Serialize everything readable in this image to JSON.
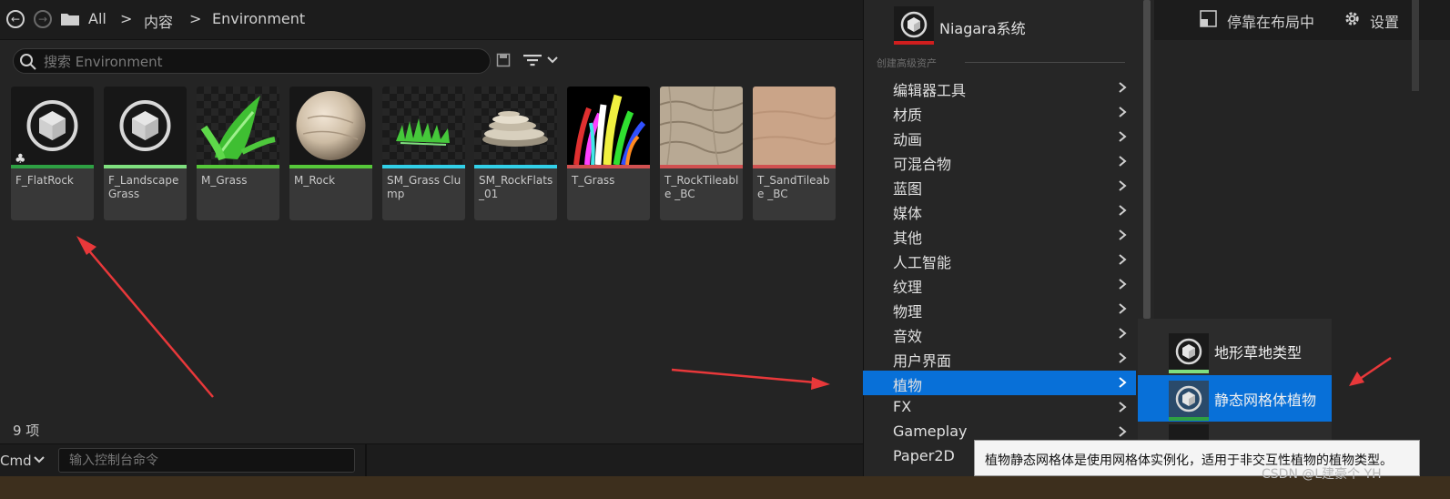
{
  "breadcrumb": {
    "items": [
      "All",
      "内容",
      "Environment"
    ],
    "separator": ">"
  },
  "search": {
    "placeholder": "搜索 Environment",
    "value": ""
  },
  "assets": [
    {
      "name": "F_FlatRock",
      "bar_color": "#2ea043",
      "thumb": "cube-icon"
    },
    {
      "name": "F_Landscape Grass",
      "bar_color": "#7fe07f",
      "thumb": "cube-icon"
    },
    {
      "name": "M_Grass",
      "bar_color": "#56c83a",
      "thumb": "grass-leaf"
    },
    {
      "name": "M_Rock",
      "bar_color": "#56c83a",
      "thumb": "rock-sphere"
    },
    {
      "name": "SM_Grass Clump",
      "bar_color": "#32d0e8",
      "thumb": "grass-clump"
    },
    {
      "name": "SM_RockFlats _01",
      "bar_color": "#32d0e8",
      "thumb": "rock-flats"
    },
    {
      "name": "T_Grass",
      "bar_color": "#d05050",
      "thumb": "grass-texture"
    },
    {
      "name": "T_RockTileable _BC",
      "bar_color": "#d05050",
      "thumb": "rock-texture"
    },
    {
      "name": "T_SandTileabe _BC",
      "bar_color": "#d05050",
      "thumb": "sand-texture"
    }
  ],
  "status": {
    "item_count": "9 项"
  },
  "console": {
    "label": "Cmd",
    "placeholder": "输入控制台命令"
  },
  "right_panel": {
    "dock_label": "停靠在布局中",
    "settings_label": "设置"
  },
  "context_menu": {
    "top_item": "Niagara系统",
    "section_header": "创建高级资产",
    "items": [
      "编辑器工具",
      "材质",
      "动画",
      "可混合物",
      "蓝图",
      "媒体",
      "其他",
      "人工智能",
      "纹理",
      "物理",
      "音效",
      "用户界面",
      "植物",
      "FX",
      "Gameplay",
      "Paper2D"
    ],
    "active_item": "植物"
  },
  "submenu": {
    "items": [
      {
        "label": "地形草地类型",
        "bar_color": "#7fe07f"
      },
      {
        "label": "静态网格体植物",
        "bar_color": "#2ea043"
      }
    ],
    "active_item": "静态网格体植物"
  },
  "tooltip": {
    "text": "植物静态网格体是使用网格体实例化，适用于非交互性植物的植物类型。"
  },
  "watermark": "CSDN @L建豪个 YH",
  "colors": {
    "accent": "#0870d8",
    "annotation_arrow": "#e8383a",
    "niagara_bar": "#d01e1e"
  }
}
